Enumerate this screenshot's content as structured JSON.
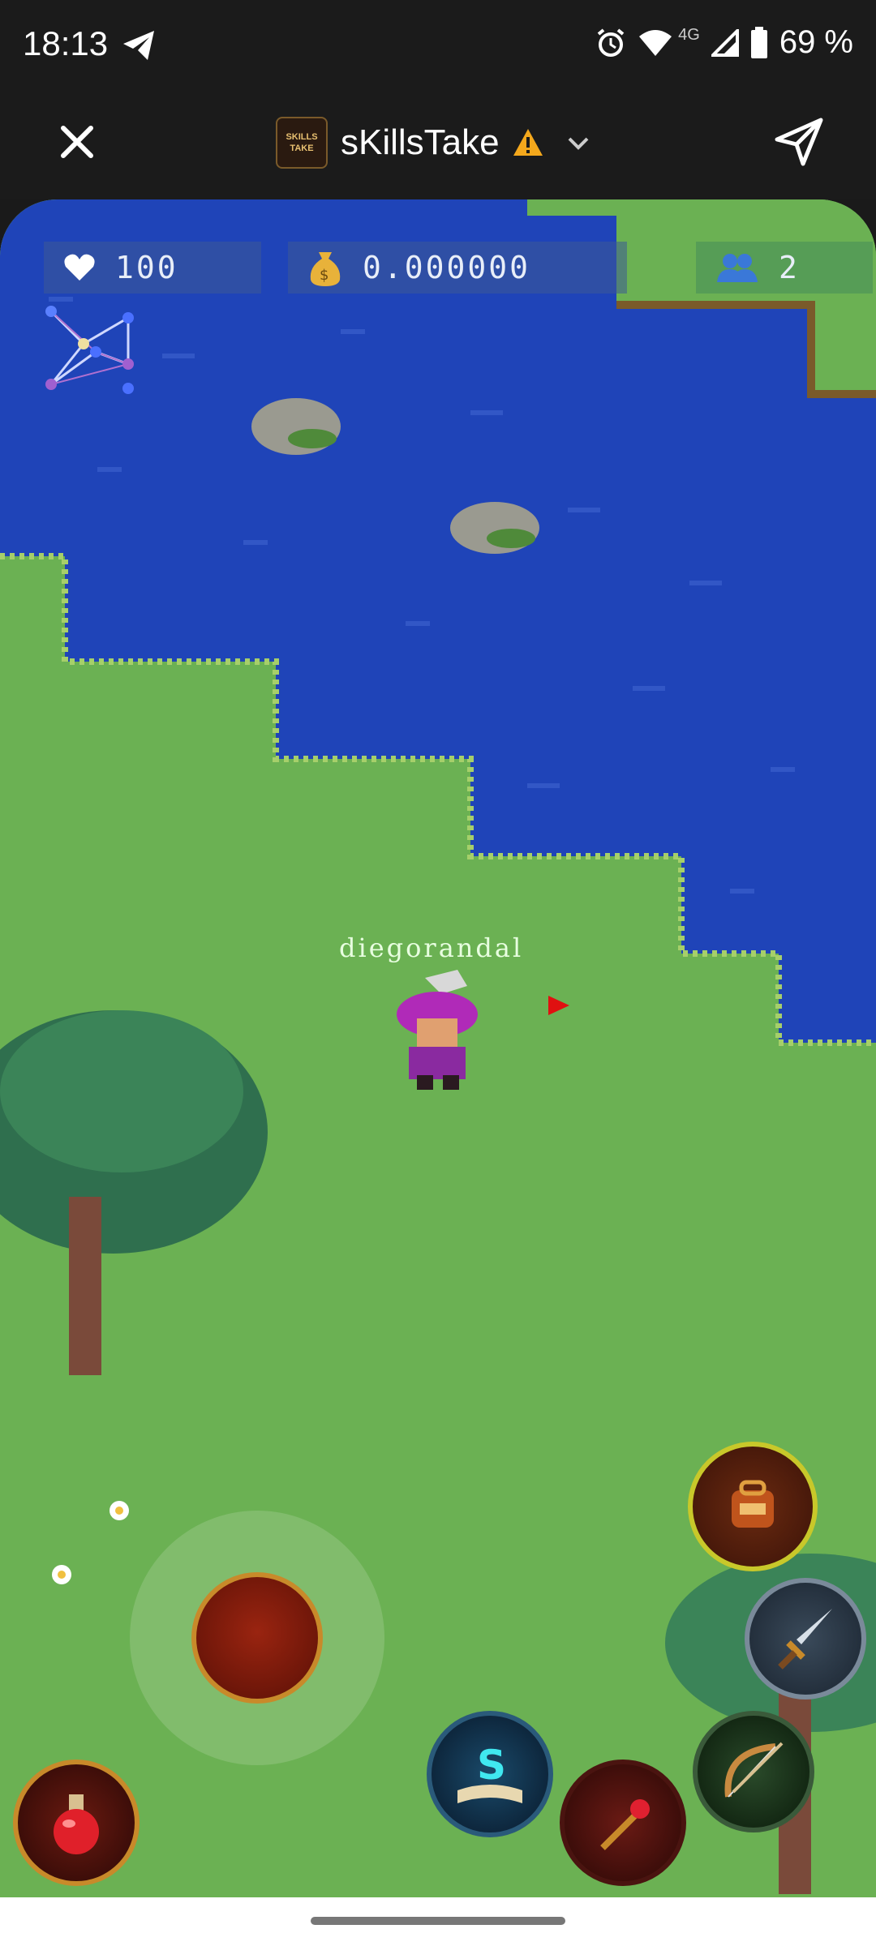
{
  "status_bar": {
    "time": "18:13",
    "network": "4G",
    "battery": "69 %"
  },
  "header": {
    "title": "sKillsTake",
    "logo_text": "SKILLS TAKE"
  },
  "hud": {
    "health": "100",
    "gold": "0.000000",
    "players": "2"
  },
  "player": {
    "name": "diegorandal"
  },
  "colors": {
    "water": "#1f44b8",
    "grass": "#6bb153",
    "hud_bg": "#3c5a96"
  },
  "icons": [
    "telegram-icon",
    "alarm-icon",
    "wifi-icon",
    "signal-icon",
    "battery-icon",
    "close-icon",
    "warning-icon",
    "chevron-down-icon",
    "share-icon",
    "heart-icon",
    "money-bag-icon",
    "players-icon",
    "skill-tree-icon",
    "potion-icon",
    "spellbook-icon",
    "staff-icon",
    "bow-icon",
    "sword-icon",
    "backpack-icon"
  ]
}
